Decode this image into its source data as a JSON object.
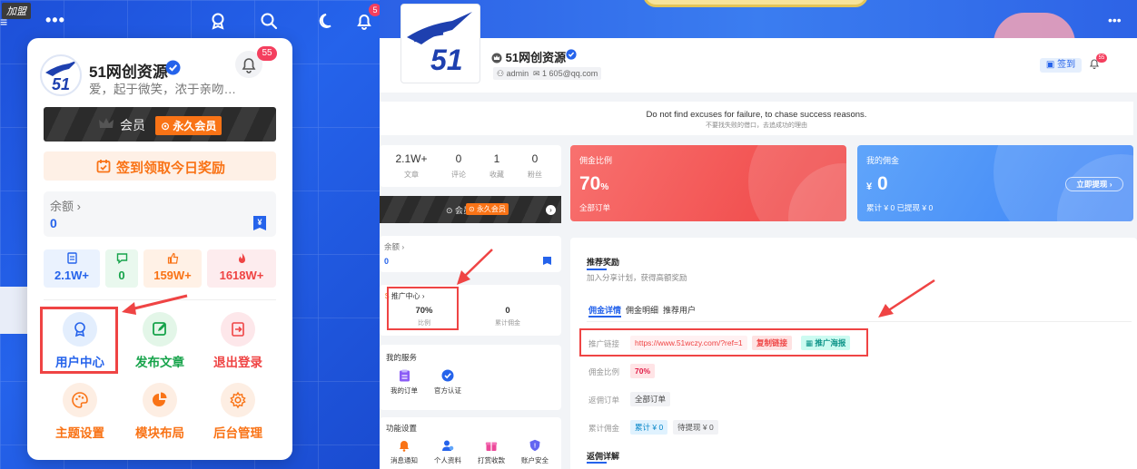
{
  "left": {
    "watermark": "加盟",
    "top_bell_badge": "5",
    "user": {
      "name": "51网创资源",
      "motto": "爱，起于微笑，浓于亲吻…",
      "notification_count": "55"
    },
    "vip": {
      "label": "会员",
      "tag": "永久会员"
    },
    "sign_in_button": "签到领取今日奖励",
    "balance": {
      "label": "余额",
      "value": "0"
    },
    "stats": [
      {
        "value": "2.1W+",
        "icon": "document-icon"
      },
      {
        "value": "0",
        "icon": "comment-icon"
      },
      {
        "value": "159W+",
        "icon": "thumbs-up-icon"
      },
      {
        "value": "1618W+",
        "icon": "fire-icon"
      }
    ],
    "menu": [
      {
        "label": "用户中心",
        "icon": "user-center-icon"
      },
      {
        "label": "发布文章",
        "icon": "edit-icon"
      },
      {
        "label": "退出登录",
        "icon": "logout-icon"
      },
      {
        "label": "主题设置",
        "icon": "palette-icon"
      },
      {
        "label": "模块布局",
        "icon": "pie-chart-icon"
      },
      {
        "label": "后台管理",
        "icon": "gear-icon"
      }
    ]
  },
  "right": {
    "profile": {
      "name": "51网创资源",
      "role": "admin",
      "email": "1          605@qq.com",
      "sign_button": "签到",
      "bell_badge": "55"
    },
    "quote": {
      "en": "Do not find excuses for failure, to chase success reasons.",
      "zh": "不要找失败的借口，去追成功的理由"
    },
    "kpis": [
      {
        "value": "2.1W+",
        "label": "文章"
      },
      {
        "value": "0",
        "label": "评论"
      },
      {
        "value": "1",
        "label": "收藏"
      },
      {
        "value": "0",
        "label": "粉丝"
      }
    ],
    "vip": {
      "label": "会员",
      "tag": "永久会员"
    },
    "balance": {
      "label": "余额 ›",
      "value": "0"
    },
    "promo": {
      "title": "推广中心 ›",
      "rate_value": "70%",
      "rate_label": "比例",
      "total_value": "0",
      "total_label": "累计佣金"
    },
    "services": {
      "title": "我的服务",
      "items": [
        {
          "label": "我的订单",
          "icon": "clipboard-icon"
        },
        {
          "label": "官方认证",
          "icon": "verified-icon"
        }
      ]
    },
    "features": {
      "title": "功能设置",
      "items": [
        {
          "label": "消息通知",
          "icon": "bell-icon"
        },
        {
          "label": "个人资料",
          "icon": "user-icon"
        },
        {
          "label": "打赏收款",
          "icon": "gift-icon"
        },
        {
          "label": "账户安全",
          "icon": "shield-icon"
        }
      ]
    },
    "commission_rate": {
      "title": "佣金比例",
      "value": "70",
      "unit": "%",
      "sub": "全部订单"
    },
    "my_commission": {
      "title": "我的佣金",
      "prefix": "¥",
      "value": "0",
      "sub": "累计 ¥ 0    已提现 ¥ 0",
      "withdraw": "立即提现 ›"
    },
    "reward": {
      "title": "推荐奖励",
      "subtitle": "加入分享计划，获得高额奖励",
      "tabs": [
        "佣金详情",
        "佣金明细",
        "推荐用户"
      ],
      "link_label": "推广链接",
      "link_url": "https://www.51wczy.com/?ref=1",
      "copy_button": "复制链接",
      "poster_button": "推广海报",
      "rate_label": "佣金比例",
      "rate_value": "70%",
      "orders_label": "返佣订单",
      "orders_value": "全部订单",
      "total_label": "累计佣金",
      "total_chip1": "累计 ¥ 0",
      "total_chip2": "待提现 ¥ 0",
      "detail_title": "返佣详解"
    }
  },
  "colors": {
    "brand_blue": "#2563eb",
    "orange": "#f97316",
    "red": "#ef4444",
    "highlight_box": "#ef4444"
  }
}
